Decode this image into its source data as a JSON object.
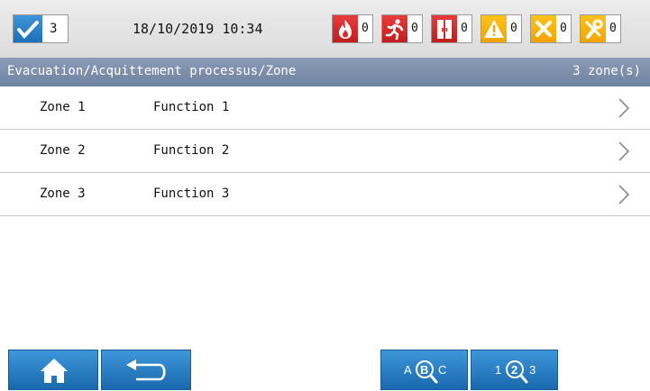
{
  "status_bar": {
    "ack_count": "3",
    "datetime": "18/10/2019 10:34",
    "alarms": [
      {
        "name": "fire",
        "count": "0"
      },
      {
        "name": "evacuation",
        "count": "0"
      },
      {
        "name": "door",
        "count": "0"
      },
      {
        "name": "warning",
        "count": "0"
      },
      {
        "name": "fault",
        "count": "0"
      },
      {
        "name": "maintenance",
        "count": "0"
      }
    ]
  },
  "title_bar": {
    "path": "Evacuation/Acquittement processus/Zone",
    "zone_count": "3 zone(s)"
  },
  "zones": [
    {
      "zone": "Zone 1",
      "function": "Function 1"
    },
    {
      "zone": "Zone 2",
      "function": "Function 2"
    },
    {
      "zone": "Zone 3",
      "function": "Function 3"
    }
  ],
  "bottom_bar": {
    "sort_alpha": {
      "left": "A",
      "mid": "B",
      "right": "C"
    },
    "sort_numeric": {
      "left": "1",
      "mid": "2",
      "right": "3"
    }
  },
  "colors": {
    "accent_blue": "#2a82c9",
    "alarm_red": "#d32a2a",
    "alarm_yellow": "#f7b20a",
    "title_bar": "#7d8fab"
  }
}
